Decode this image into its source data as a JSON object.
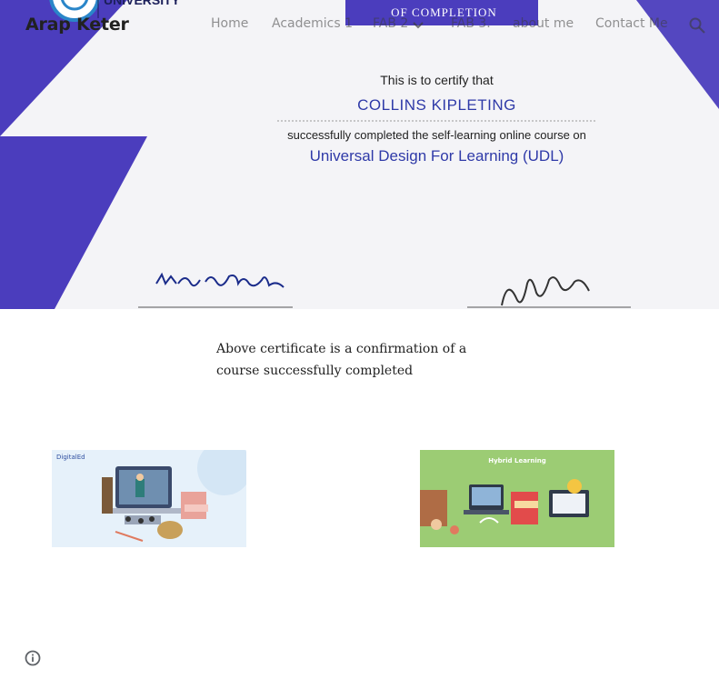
{
  "site": {
    "title": "Arap Keter"
  },
  "nav": {
    "items": [
      {
        "label": "Home",
        "has_dropdown": false
      },
      {
        "label": "Academics 1",
        "has_dropdown": false
      },
      {
        "label": "FAB 2",
        "has_dropdown": true
      },
      {
        "label": "FAB 3.",
        "has_dropdown": false
      },
      {
        "label": "about me",
        "has_dropdown": false
      },
      {
        "label": "Contact Me",
        "has_dropdown": false
      }
    ],
    "search_icon": "search-icon"
  },
  "hero": {
    "university": "UNIVERSITY",
    "completion": "OF COMPLETION",
    "intro": "This is to certify that",
    "name": "COLLINS KIPLETING",
    "line": "successfully completed the self-learning online course on",
    "course": "Universal Design For Learning (UDL)",
    "signatures": [
      "Kma Kanjelal"
    ],
    "colors": {
      "accent": "#4b3dbd",
      "text_blue": "#2f3aa8"
    }
  },
  "content": {
    "paragraph": "Above certificate is a confirmation of a course successfully completed"
  },
  "images": {
    "left": {
      "brand": "DigitalEd",
      "icon": "online-classroom-illustration"
    },
    "right": {
      "title": "Hybrid Learning",
      "icon": "hybrid-learning-illustration"
    }
  },
  "footer": {
    "info_icon": "info-icon"
  }
}
